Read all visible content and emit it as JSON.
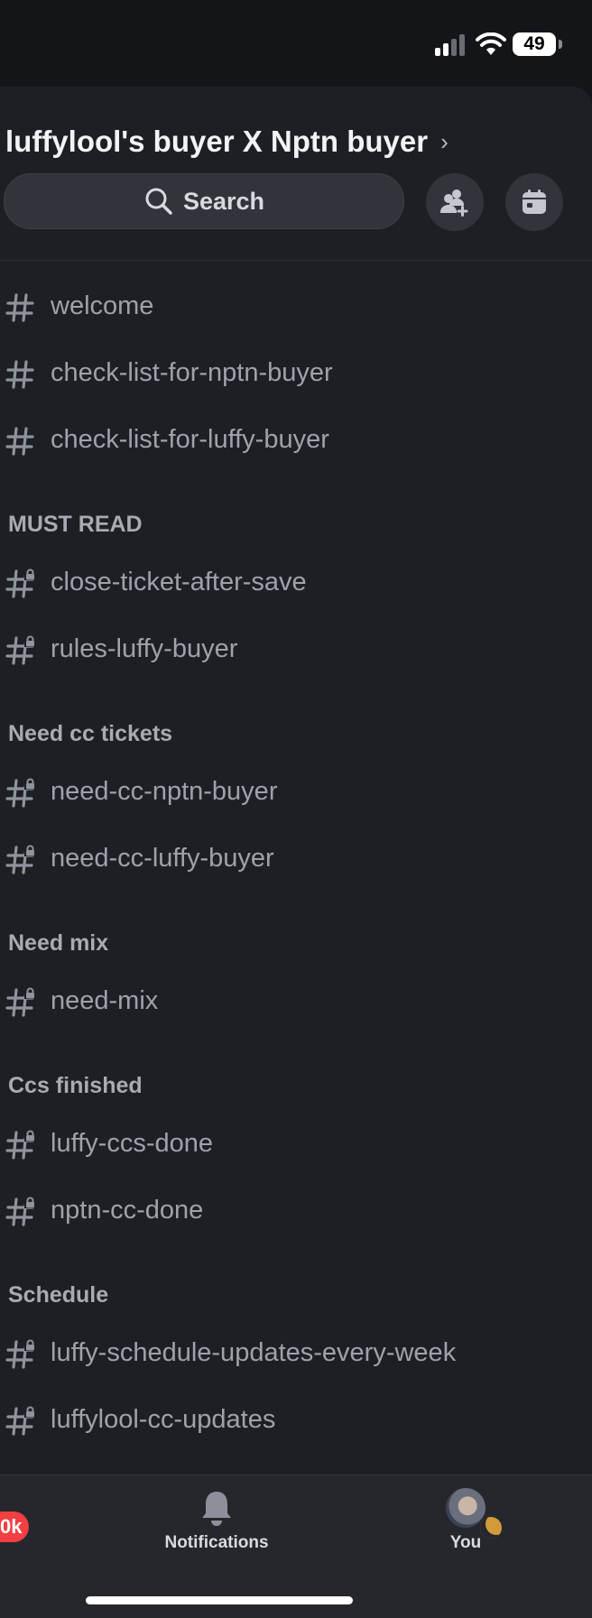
{
  "status_bar": {
    "battery": "49"
  },
  "server": {
    "title": "luffylool's buyer X Nptn buyer"
  },
  "search": {
    "label": "Search"
  },
  "channels": [
    {
      "type": "channel",
      "name": "welcome",
      "locked": false
    },
    {
      "type": "channel",
      "name": "check-list-for-nptn-buyer",
      "locked": false
    },
    {
      "type": "channel",
      "name": "check-list-for-luffy-buyer",
      "locked": false
    },
    {
      "type": "category",
      "name": "MUST READ"
    },
    {
      "type": "channel",
      "name": "close-ticket-after-save",
      "locked": true
    },
    {
      "type": "channel",
      "name": "rules-luffy-buyer",
      "locked": true
    },
    {
      "type": "category",
      "name": "Need cc tickets"
    },
    {
      "type": "channel",
      "name": "need-cc-nptn-buyer",
      "locked": true
    },
    {
      "type": "channel",
      "name": "need-cc-luffy-buyer",
      "locked": true
    },
    {
      "type": "category",
      "name": "Need mix"
    },
    {
      "type": "channel",
      "name": "need-mix",
      "locked": true
    },
    {
      "type": "category",
      "name": "Ccs finished"
    },
    {
      "type": "channel",
      "name": "luffy-ccs-done",
      "locked": true
    },
    {
      "type": "channel",
      "name": "nptn-cc-done",
      "locked": true
    },
    {
      "type": "category",
      "name": "Schedule"
    },
    {
      "type": "channel",
      "name": "luffy-schedule-updates-every-week",
      "locked": true
    },
    {
      "type": "channel",
      "name": "luffylool-cc-updates",
      "locked": true
    }
  ],
  "tabbar": {
    "badge": "0k",
    "notifications_label": "Notifications",
    "you_label": "You"
  },
  "icons": {
    "search": "search-icon",
    "invite": "add-member-icon",
    "events": "calendar-icon",
    "channel": "hash-icon",
    "locked_channel": "locked-hash-icon",
    "notifications": "bell-icon"
  },
  "colors": {
    "background": "#1e1f24",
    "status_background": "#141519",
    "channel_text": "#9ea2ab",
    "category_text": "#a8abb3",
    "badge": "#f23f43"
  }
}
